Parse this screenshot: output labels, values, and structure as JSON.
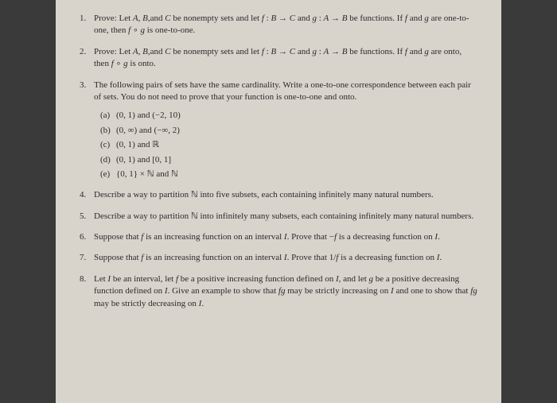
{
  "items": [
    {
      "text": "Prove: Let <span class='math-i'>A</span>, <span class='math-i'>B</span>,and <span class='math-i'>C</span> be nonempty sets and let <span class='math-i'>f</span> : <span class='math-i'>B</span> → <span class='math-i'>C</span> and <span class='math-i'>g</span> : <span class='math-i'>A</span> → <span class='math-i'>B</span> be functions. If <span class='math-i'>f</span> and <span class='math-i'>g</span> are one-to-one, then <span class='math-i'>f</span> ∘ <span class='math-i'>g</span> is one-to-one."
    },
    {
      "text": "Prove: Let <span class='math-i'>A</span>, <span class='math-i'>B</span>,and <span class='math-i'>C</span> be nonempty sets and let <span class='math-i'>f</span> : <span class='math-i'>B</span> → <span class='math-i'>C</span> and <span class='math-i'>g</span> : <span class='math-i'>A</span> → <span class='math-i'>B</span> be functions. If <span class='math-i'>f</span> and <span class='math-i'>g</span> are onto, then <span class='math-i'>f</span> ∘ <span class='math-i'>g</span> is onto."
    },
    {
      "text": "The following pairs of sets have the same cardinality. Write a one-to-one correspondence between each pair of sets. You do not need to prove that your function is one-to-one and onto.",
      "subitems": [
        {
          "label": "(a)",
          "text": "(0, 1) and (−2, 10)"
        },
        {
          "label": "(b)",
          "text": "(0, ∞) and (−∞, 2)"
        },
        {
          "label": "(c)",
          "text": "(0, 1) and <span class='bb'>ℝ</span>"
        },
        {
          "label": "(d)",
          "text": "(0, 1) and [0, 1]"
        },
        {
          "label": "(e)",
          "text": "{0, 1} × <span class='bb'>ℕ</span> and <span class='bb'>ℕ</span>"
        }
      ]
    },
    {
      "text": "Describe a way to partition <span class='bb'>ℕ</span> into five subsets, each containing infinitely many natural numbers."
    },
    {
      "text": "Describe a way to partition <span class='bb'>ℕ</span> into infinitely many subsets, each containing infinitely many natural numbers."
    },
    {
      "text": "Suppose that <span class='math-i'>f</span> is an increasing function on an interval <span class='math-i'>I</span>. Prove that −<span class='math-i'>f</span> is a decreasing function on <span class='math-i'>I</span>."
    },
    {
      "text": "Suppose that <span class='math-i'>f</span> is an increasing function on an interval <span class='math-i'>I</span>. Prove that 1/<span class='math-i'>f</span> is a decreasing function on <span class='math-i'>I</span>."
    },
    {
      "text": "Let <span class='math-i'>I</span> be an interval, let <span class='math-i'>f</span> be a positive increasing function defined on <span class='math-i'>I</span>, and let <span class='math-i'>g</span> be a positive decreasing function defined on <span class='math-i'>I</span>. Give an example to show that <span class='math-i'>fg</span> may be strictly increasing on <span class='math-i'>I</span> and one to show that <span class='math-i'>fg</span> may be strictly decreasing on <span class='math-i'>I</span>."
    }
  ]
}
